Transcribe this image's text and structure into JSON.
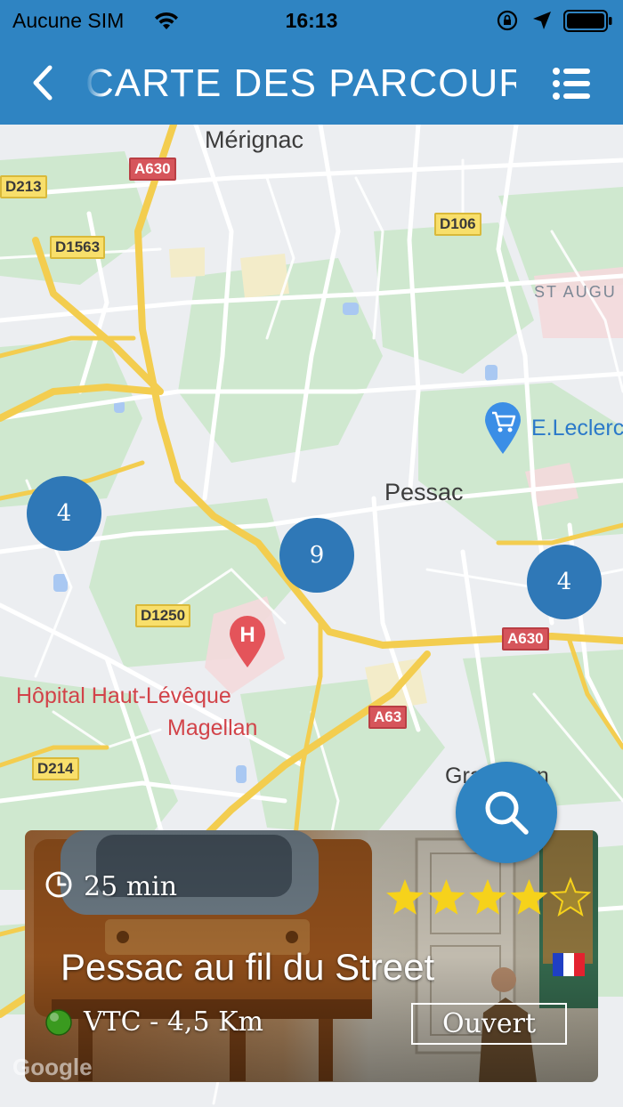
{
  "status_bar": {
    "carrier": "Aucune SIM",
    "time": "16:13"
  },
  "header": {
    "title": "CARTE DES PARCOURS",
    "back_icon": "chevron-left-icon",
    "menu_icon": "list-menu-icon"
  },
  "map": {
    "labels": {
      "merignac": "Mérignac",
      "pessac": "Pessac",
      "st_augustin": "ST AUGU",
      "leclerc": "E.Leclerc",
      "hopital_line1": "Hôpital Haut-Lévêque",
      "hopital_line2": "Magellan",
      "gradignan": "Gradignan"
    },
    "roads": {
      "a630_top": "A630",
      "d213": "D213",
      "d1563": "D1563",
      "d106": "D106",
      "d1250": "D1250",
      "a630_right": "A630",
      "a63": "A63",
      "d214": "D214"
    },
    "clusters": {
      "left": "4",
      "center": "9",
      "right": "4"
    }
  },
  "card": {
    "duration": "25 min",
    "rating": 4,
    "rating_max": 5,
    "title": "Pessac au fil du Street Art",
    "flag": "france-flag-icon",
    "difficulty_color": "#3a9a1f",
    "info": "VTC - 4,5 Km",
    "status": "Ouvert"
  },
  "colors": {
    "primary": "#2f84c2",
    "cluster": "#2f78b7",
    "star": "#f6d21b"
  }
}
